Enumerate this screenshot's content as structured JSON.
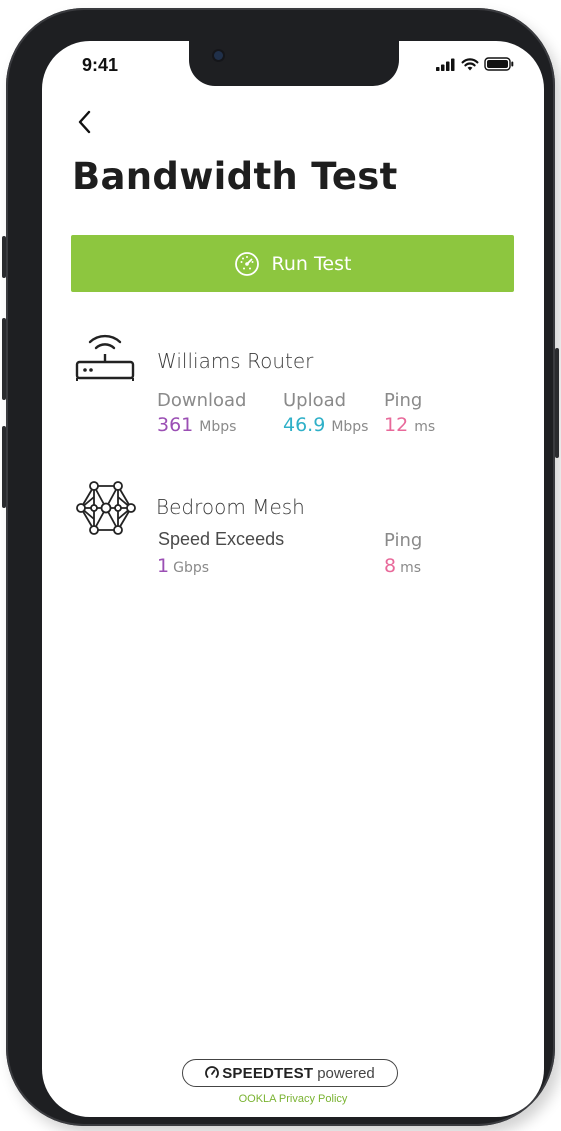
{
  "status_bar": {
    "time": "9:41"
  },
  "header": {
    "title": "Bandwidth Test"
  },
  "run_test": {
    "label": "Run Test",
    "color": "#8dc63f"
  },
  "devices": [
    {
      "name": "Williams Router",
      "icon": "router-icon",
      "download": {
        "label": "Download",
        "value": "361",
        "unit": "Mbps"
      },
      "upload": {
        "label": "Upload",
        "value": "46.9",
        "unit": "Mbps"
      },
      "ping": {
        "label": "Ping",
        "value": "12",
        "unit": "ms"
      }
    },
    {
      "name": "Bedroom Mesh",
      "icon": "mesh-network-icon",
      "speed": {
        "label": "Speed Exceeds",
        "value": "1",
        "unit": "Gbps"
      },
      "ping": {
        "label": "Ping",
        "value": "8",
        "unit": "ms"
      }
    }
  ],
  "colors": {
    "download": "#9b4fb4",
    "upload": "#2fb0c8",
    "ping": "#e8699a"
  },
  "footer": {
    "logo_bold": "SPEEDTEST",
    "logo_suffix": "powered",
    "privacy": "OOKLA Privacy Policy"
  }
}
